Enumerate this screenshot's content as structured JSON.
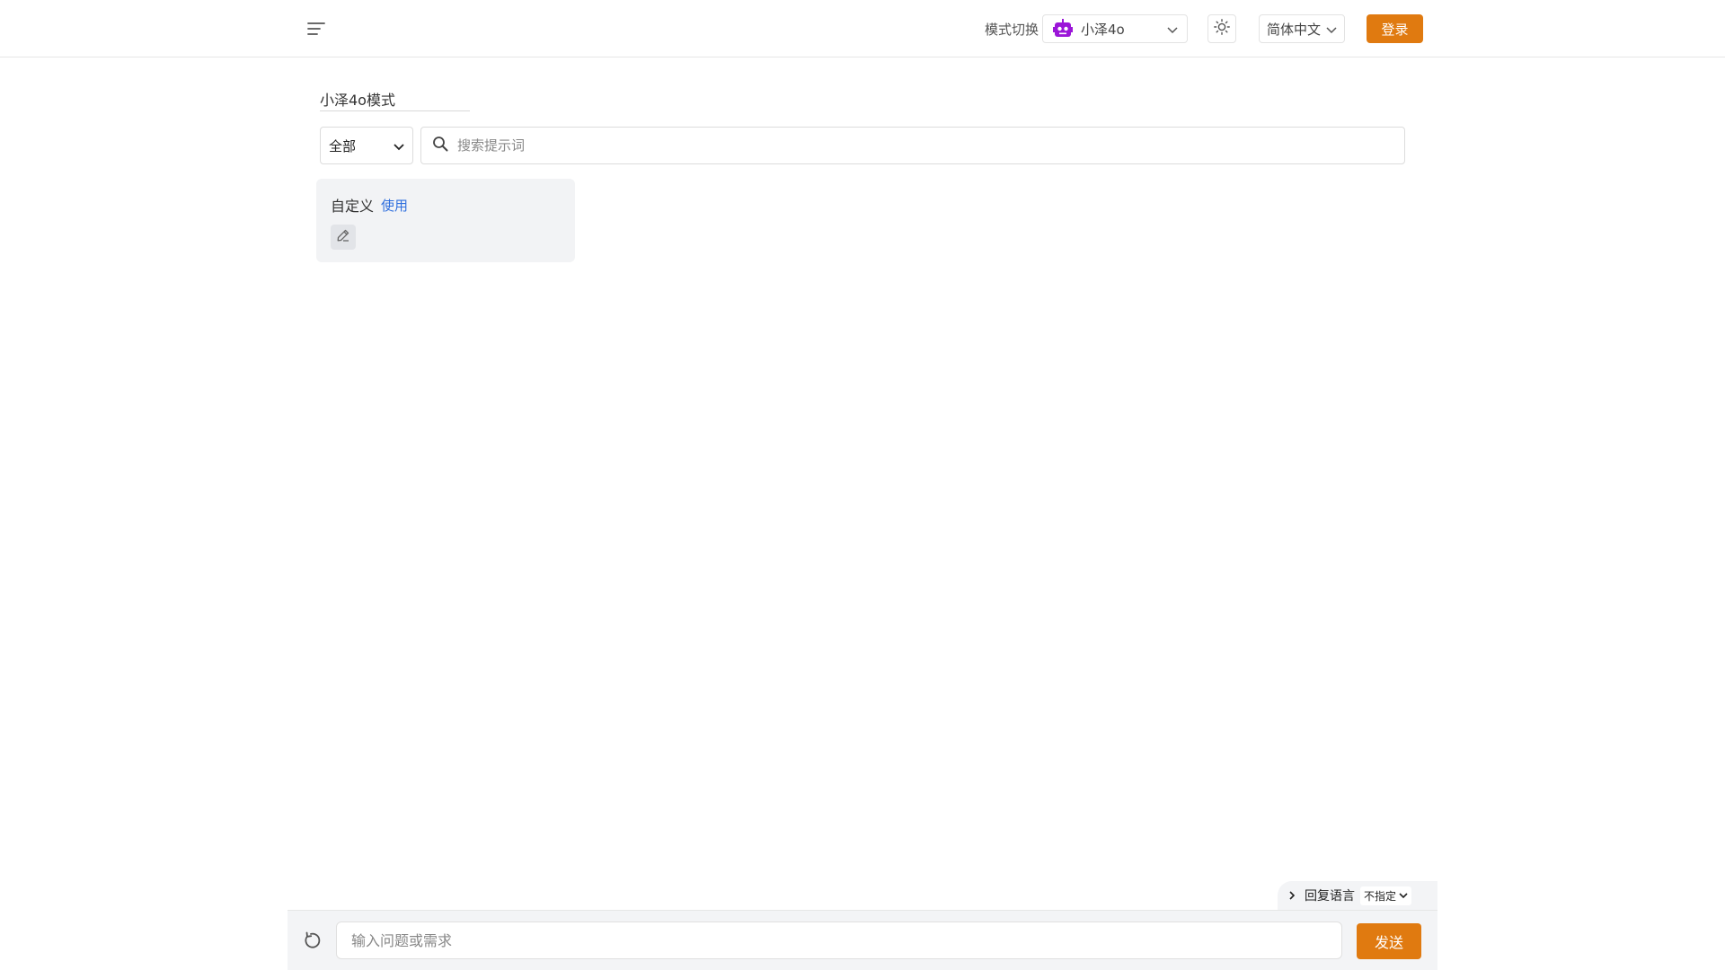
{
  "header": {
    "menu_icon": "hamburger-menu-icon",
    "mode_switch_label": "模式切换",
    "model_select": {
      "icon": "robot-icon",
      "value": "小泽4o",
      "icon_color": "#9b16d8"
    },
    "theme_icon": "sun-icon",
    "language_select": {
      "value": "简体中文"
    },
    "login_label": "登录"
  },
  "main": {
    "mode_title": "小泽4o模式",
    "category_select": {
      "value": "全部"
    },
    "search": {
      "placeholder": "搜索提示词",
      "value": "",
      "icon": "search-icon"
    },
    "prompt_cards": [
      {
        "title": "自定义",
        "use_label": "使用",
        "edit_icon": "edit-pencil-icon"
      }
    ]
  },
  "footer": {
    "reply_language": {
      "label": "回复语言",
      "value": "不指定"
    },
    "refresh_icon": "refresh-icon",
    "chat_input": {
      "placeholder": "输入问题或需求",
      "value": ""
    },
    "send_label": "发送"
  },
  "colors": {
    "accent": "#e07a10",
    "link": "#2f6fde",
    "card_bg": "#f2f3f5",
    "robot": "#9b16d8"
  }
}
